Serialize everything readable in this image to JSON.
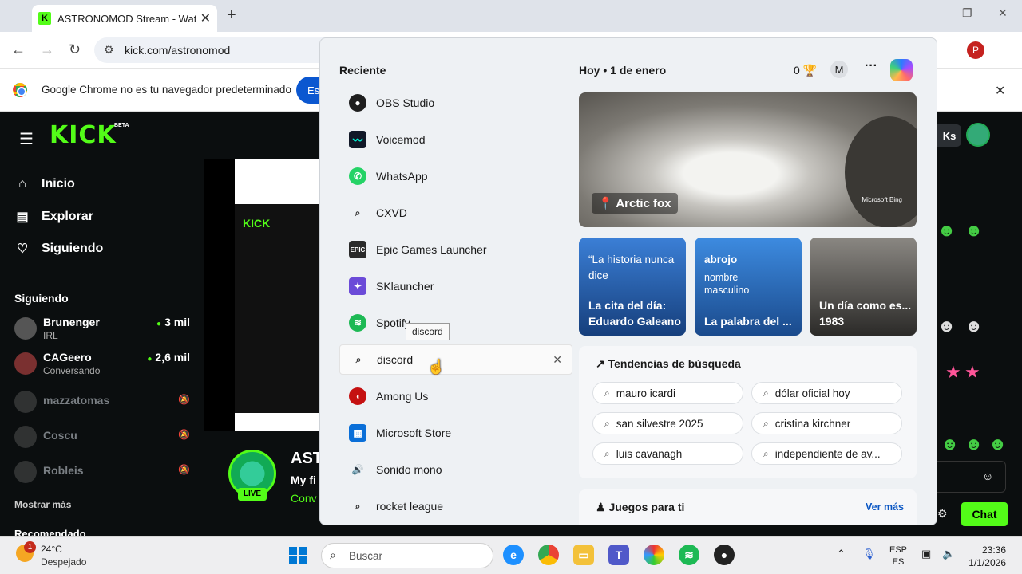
{
  "browser": {
    "tab_title": "ASTRONOMOD Stream - Watch",
    "url": "kick.com/astronomod",
    "profile_initial": "P",
    "infobar_text": "Google Chrome no es tu navegador predeterminado",
    "infobar_button": "Es"
  },
  "kick": {
    "logo": "KICK",
    "beta": "BETA",
    "nav": [
      {
        "label": "Inicio",
        "icon": "home-icon"
      },
      {
        "label": "Explorar",
        "icon": "browse-icon"
      },
      {
        "label": "Siguiendo",
        "icon": "heart-icon"
      }
    ],
    "following_header": "Siguiendo",
    "following": [
      {
        "name": "Brunenger",
        "sub": "IRL",
        "count": "3 mil",
        "live": true
      },
      {
        "name": "CAGeero",
        "sub": "Conversando",
        "count": "2,6 mil",
        "live": true
      },
      {
        "name": "mazzatomas",
        "live": false
      },
      {
        "name": "Coscu",
        "live": false
      },
      {
        "name": "Robleis",
        "live": false
      }
    ],
    "show_more": "Mostrar más",
    "recommended": "Recomendado",
    "channel_name": "AST",
    "channel_title": "My fi",
    "channel_category": "Conv",
    "live_badge": "LIVE",
    "ks_label": "Ks",
    "chat_button": "Chat"
  },
  "start_menu": {
    "recent_header": "Reciente",
    "recent": [
      {
        "label": "OBS Studio",
        "icon": "obs-icon",
        "color": "#1e1e1e"
      },
      {
        "label": "Voicemod",
        "icon": "voicemod-icon",
        "color": "#111827"
      },
      {
        "label": "WhatsApp",
        "icon": "whatsapp-icon",
        "color": "#25d366"
      },
      {
        "label": "CXVD",
        "icon": "search-icon",
        "color": "none"
      },
      {
        "label": "Epic Games Launcher",
        "icon": "epic-games-icon",
        "color": "#2a2a2a"
      },
      {
        "label": "SKlauncher",
        "icon": "sklauncher-icon",
        "color": "#6b4bd8"
      },
      {
        "label": "Spotify",
        "icon": "spotify-icon",
        "color": "#1db954"
      },
      {
        "label": "discord",
        "icon": "search-icon",
        "color": "none",
        "selected": true
      },
      {
        "label": "Among Us",
        "icon": "among-us-icon",
        "color": "#c51111"
      },
      {
        "label": "Microsoft Store",
        "icon": "store-icon",
        "color": "#0a6fd8"
      },
      {
        "label": "Sonido mono",
        "icon": "speaker-icon",
        "color": "none"
      },
      {
        "label": "rocket league",
        "icon": "search-icon",
        "color": "none"
      }
    ],
    "tooltip": "discord",
    "today_label": "Hoy",
    "date_label": "1 de enero",
    "points": "0",
    "avatar_initial": "M",
    "hero": {
      "label": "Arctic fox",
      "brand": "Microsoft Bing"
    },
    "cards": [
      {
        "top": "“La historia nunca dice",
        "bottom": "La cita del día: Eduardo Galeano",
        "color": "#1f5fb4"
      },
      {
        "top": "abrojo",
        "subtop": "nombre masculino",
        "bottom": "La palabra del ...",
        "color": "#2270c9"
      },
      {
        "top": "",
        "bottom": "Un día como es... 1983",
        "color": "#6d6a66"
      }
    ],
    "trends_header": "Tendencias de búsqueda",
    "trends": [
      "mauro icardi",
      "dólar oficial hoy",
      "san silvestre 2025",
      "cristina kirchner",
      "luis cavanagh",
      "independiente de av..."
    ],
    "games_header": "Juegos para ti",
    "games_more": "Ver más"
  },
  "taskbar": {
    "weather_temp": "24°C",
    "weather_desc": "Despejado",
    "weather_badge": "1",
    "search_placeholder": "Buscar",
    "lang_top": "ESP",
    "lang_bottom": "ES",
    "time": "23:36",
    "date": "1/1/2026"
  }
}
